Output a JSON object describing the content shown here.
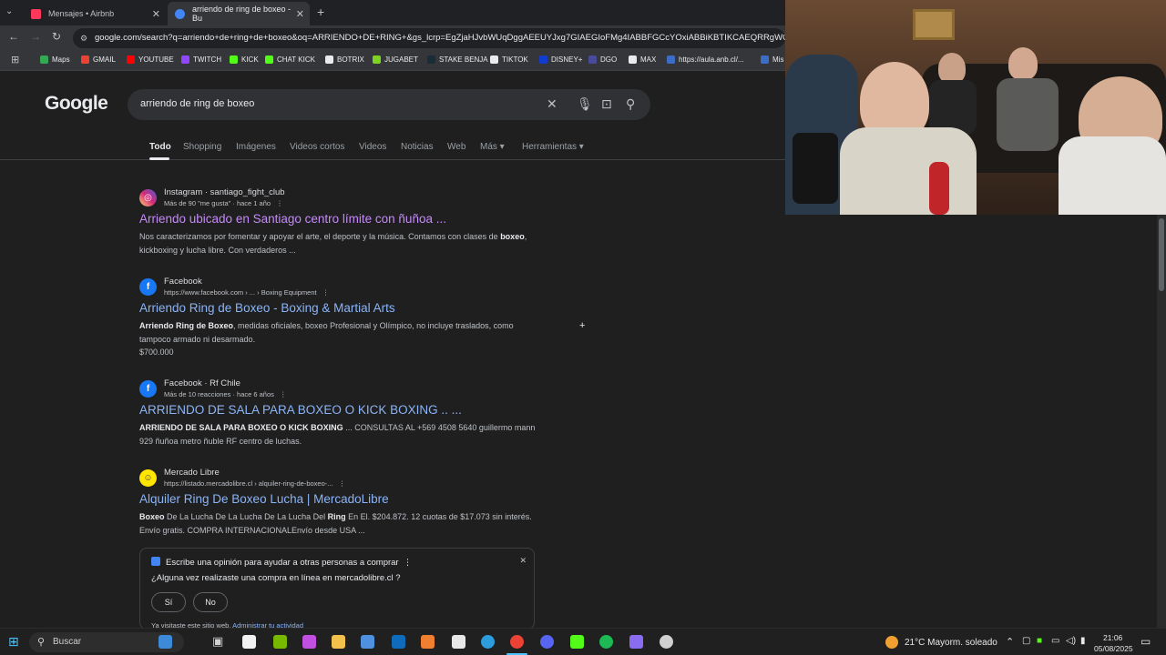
{
  "tabs": [
    {
      "label": "Mensajes • Airbnb",
      "active": false,
      "favicon_color": "#ff385c"
    },
    {
      "label": "arriendo de ring de boxeo - Bu",
      "active": true,
      "favicon_color": "#4285f4"
    }
  ],
  "address": {
    "url": "google.com/search?q=arriendo+de+ring+de+boxeo&oq=ARRIENDO+DE+RING+&gs_lcrp=EgZjaHJvbWUqDggAEEUYJxg7GIAEGIoFMg4IABBFGCcYOxiABBiKBTIKCAEQRRgWGB4YOTI("
  },
  "bookmarks": [
    {
      "label": "Maps",
      "color": "#34a853"
    },
    {
      "label": "GMAIL",
      "color": "#ea4335"
    },
    {
      "label": "YOUTUBE",
      "color": "#ff0000"
    },
    {
      "label": "TWITCH",
      "color": "#9146ff"
    },
    {
      "label": "KICK",
      "color": "#53fc18"
    },
    {
      "label": "CHAT KICK",
      "color": "#53fc18"
    },
    {
      "label": "BOTRIX",
      "color": "#e8eaed"
    },
    {
      "label": "JUGABET",
      "color": "#7ed321"
    },
    {
      "label": "STAKE BENJA",
      "color": "#1a2c38"
    },
    {
      "label": "TIKTOK",
      "color": "#e8eaed"
    },
    {
      "label": "DISNEY+",
      "color": "#113ccf"
    },
    {
      "label": "DGO",
      "color": "#4a4a9a"
    },
    {
      "label": "MAX",
      "color": "#e8eaed"
    },
    {
      "label": "https://aula.anb.cl/...",
      "color": "#3b6cc6"
    },
    {
      "label": "Mis",
      "color": "#3b6cc6"
    }
  ],
  "google": {
    "logo": "Google",
    "query": "arriendo de ring de boxeo",
    "search_tabs": [
      "Todo",
      "Shopping",
      "Imágenes",
      "Videos cortos",
      "Videos",
      "Noticias",
      "Web",
      "Más ▾",
      "Herramientas ▾"
    ]
  },
  "results": [
    {
      "source": "Instagram · santiago_fight_club",
      "sub": "Más de 90 \"me gusta\" · hace 1 año",
      "title": "Arriendo ubicado en Santiago centro límite con ñuñoa ...",
      "visited": true,
      "icon": "instagram-icon",
      "icon_color": "#d62976",
      "icon_glyph": "◎",
      "snippet_html": "Nos caracterizamos por fomentar y apoyar el arte, el deporte y la música. Contamos con clases de <b>boxeo</b>, kickboxing y lucha libre. Con verdaderos ..."
    },
    {
      "source": "Facebook",
      "sub": "https://www.facebook.com › ... › Boxing Equipment",
      "title": "Arriendo Ring de Boxeo - Boxing & Martial Arts",
      "visited": false,
      "icon": "facebook-icon",
      "icon_color": "#1877f2",
      "icon_glyph": "f",
      "snippet_html": "<b>Arriendo Ring de Boxeo</b>, medidas oficiales, boxeo Profesional y Olímpico, no incluye traslados, como tampoco armado ni desarmado.",
      "price": "$700.000"
    },
    {
      "source": "Facebook · Rf Chile",
      "sub": "Más de 10 reacciones · hace 6 años",
      "title": "ARRIENDO DE SALA PARA BOXEO O KICK BOXING .. ...",
      "visited": false,
      "icon": "facebook-icon",
      "icon_color": "#1877f2",
      "icon_glyph": "f",
      "snippet_html": "<b>ARRIENDO DE SALA PARA BOXEO O KICK BOXING</b> ... CONSULTAS AL +569 4508 5640 guillermo mann 929 ñuñoa metro ñuble RF centro de luchas."
    },
    {
      "source": "Mercado Libre",
      "sub": "https://listado.mercadolibre.cl › alquiler-ring-de-boxeo-...",
      "title": "Alquiler Ring De Boxeo Lucha | MercadoLibre",
      "visited": false,
      "icon": "mercadolibre-icon",
      "icon_color": "#ffe600",
      "icon_glyph": "☺",
      "snippet_html": "<b>Boxeo</b> De La Lucha De La Lucha De La Lucha Del <b>Ring</b> En El. $204.872. 12 cuotas de $17.073 sin interés. Envío gratis. COMPRA INTERNACIONALEnvío desde USA ..."
    }
  ],
  "feedback": {
    "prompt": "Escribe una opinión para ayudar a otras personas a comprar",
    "question": "¿Alguna vez realizaste una compra en línea en mercadolibre.cl ?",
    "yes": "Sí",
    "no": "No",
    "visited_text": "Ya visitaste este sitio web.",
    "manage_link": "Administrar tu actividad"
  },
  "taskbar": {
    "search_placeholder": "Buscar",
    "weather": "21°C  Mayorm. soleado",
    "time": "21:06",
    "date": "05/08/2025",
    "apps": [
      {
        "name": "file-explorer-icon",
        "color": "#3c8ad8"
      },
      {
        "name": "store-icon",
        "color": "#f2f2f2"
      },
      {
        "name": "nvidia-icon",
        "color": "#76b900"
      },
      {
        "name": "copilot-icon",
        "color": "#c150e0"
      },
      {
        "name": "folder-icon",
        "color": "#f3c04c"
      },
      {
        "name": "files-icon",
        "color": "#5090e0"
      },
      {
        "name": "outlook-icon",
        "color": "#0f6cbd"
      },
      {
        "name": "app-orange-icon",
        "color": "#f08030"
      },
      {
        "name": "capcut-icon",
        "color": "#e8e8e8"
      },
      {
        "name": "edge-icon",
        "color": "#2c9cdc"
      },
      {
        "name": "chrome-icon",
        "color": "#ea4335"
      },
      {
        "name": "discord-icon",
        "color": "#5865f2"
      },
      {
        "name": "app-green-icon",
        "color": "#53fc18"
      },
      {
        "name": "spotify-icon",
        "color": "#1db954"
      },
      {
        "name": "app-purple-icon",
        "color": "#8a6cf0"
      },
      {
        "name": "obs-icon",
        "color": "#d0d0d0"
      }
    ]
  }
}
